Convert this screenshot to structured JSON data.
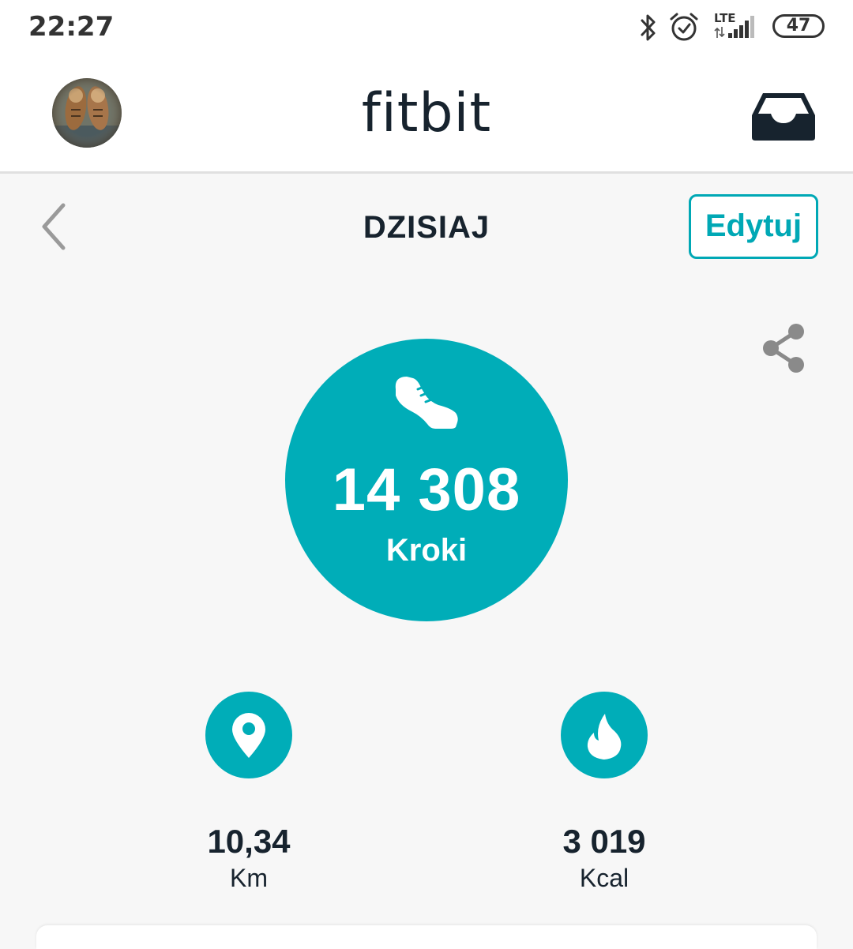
{
  "status_bar": {
    "time": "22:27",
    "network": "LTE",
    "battery": "47",
    "icons": [
      "bluetooth-icon",
      "alarm-icon",
      "signal-icon",
      "battery-icon"
    ]
  },
  "header": {
    "logo": "fitbit",
    "avatar_icon": "avatar",
    "inbox_icon": "inbox-icon"
  },
  "nav": {
    "title": "DZISIAJ",
    "edit_label": "Edytuj",
    "back_icon": "chevron-left-icon",
    "share_icon": "share-icon"
  },
  "steps": {
    "value": "14 308",
    "label": "Kroki",
    "icon": "shoe-icon"
  },
  "stats": [
    {
      "value": "10,34",
      "unit": "Km",
      "icon": "location-pin-icon"
    },
    {
      "value": "3 019",
      "unit": "Kcal",
      "icon": "flame-icon"
    }
  ],
  "colors": {
    "accent": "#00adb8",
    "text_dark": "#17232e",
    "background": "#f7f7f7"
  }
}
